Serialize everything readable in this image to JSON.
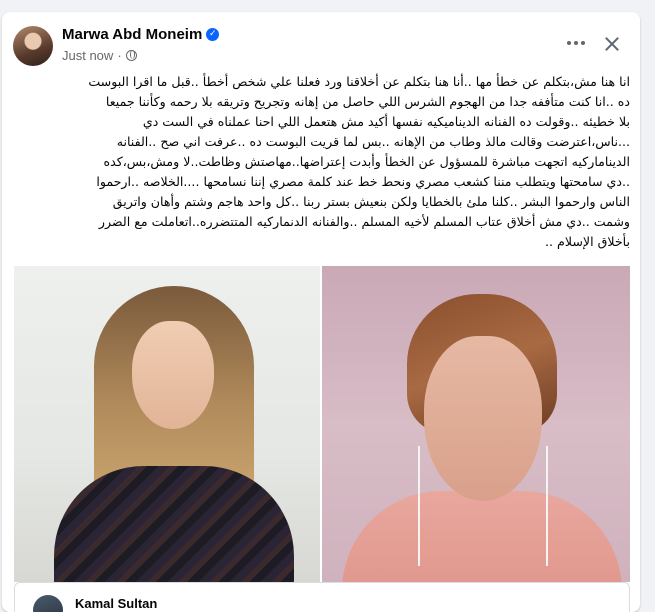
{
  "post": {
    "author": "Marwa Abd Moneim",
    "timestamp": "Just now",
    "separator": "·",
    "verified_icon": "verified-badge-icon",
    "privacy_icon": "globe-icon",
    "text_lines": [
      "انا هنا مش،بتكلم عن خطأ مها ..أنا هنا بتكلم عن أخلاقنا ورد فعلنا علي شخص أخطأ ..قبل ما اقرا البوست",
      "ده ..انا كنت متأففه جدا من الهجوم الشرس اللي حاصل من إهانه وتجريح  وتريقه بلا رحمه وكأننا جميعا",
      "بلا خطيئه ..وقولت ده الفنانه الديناميكيه نفسها أكيد مش هتعمل اللي احنا عملناه في الست دي",
      "...ناس،اعترضت وقالت مالذ وطاب من الإهانه ..بس لما قريت البوست ده ..عرفت اني صح ..الفنانه",
      "الديناماركيه اتجهت مباشرة للمسؤول عن الخطأ وأبدت إعتراضها..مهاصتش وظاطت..لا ومش،بس،كده",
      "..دي سامحتها ويتطلب مننا كشعب مصري ونحط خط عند كلمة مصري إننا نسامحها ....الخلاصه ..ارحموا",
      "الناس وارحموا البشر ..كلنا ملئ بالخطايا ولكن بنعيش بستر ربنا ..كل واحد هاجم وشتم وأهان واتريق",
      "وشمت ..دي مش أخلاق عتاب المسلم لأخيه المسلم ..والفنانه الدنماركيه المتتضرره..اتعاملت مع الضرر",
      "بأخلاق الإسلام .."
    ]
  },
  "header_actions": {
    "more_icon": "more-horizontal-icon",
    "close_icon": "close-icon"
  },
  "photos": [
    {
      "name": "photo-left",
      "description_icon": "image"
    },
    {
      "name": "photo-right",
      "description_icon": "image"
    }
  ],
  "comment": {
    "author": "Kamal Sultan"
  },
  "colors": {
    "page_bg": "#f0f2f5",
    "card_bg": "#ffffff",
    "verified": "#0866ff",
    "secondary_text": "#65676b"
  }
}
